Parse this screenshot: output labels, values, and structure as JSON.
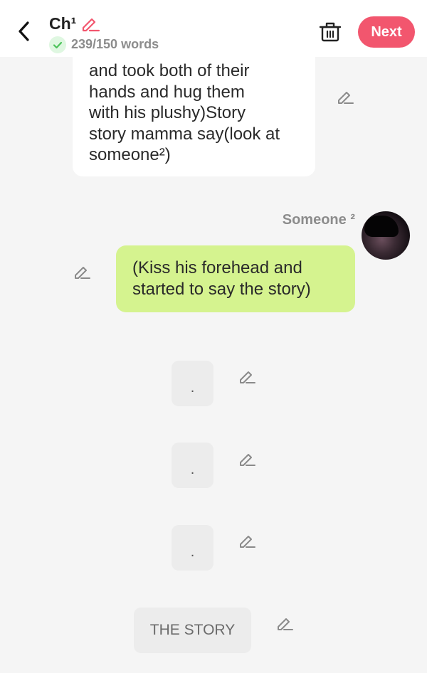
{
  "header": {
    "chapter_title": "Ch¹",
    "word_count": "239/150 words",
    "next_label": "Next"
  },
  "messages": [
    {
      "type": "text-bubble",
      "text": "and took both of their\nhands and hug them\nwith his plushy)Story\nstory mamma say(look at\nsomeone²)"
    },
    {
      "type": "speaker-bubble",
      "speaker": "Someone ²",
      "text": "(Kiss his forehead and started to say the story)",
      "background": "#d5f38f"
    },
    {
      "type": "narration",
      "text": "."
    },
    {
      "type": "narration",
      "text": "."
    },
    {
      "type": "narration",
      "text": "."
    },
    {
      "type": "narration",
      "text": "THE STORY"
    }
  ],
  "colors": {
    "accent": "#f2566e",
    "check": "#4cc35a",
    "edit_icon": "#8a8a8a",
    "background": "#f5f5f5"
  },
  "icons": [
    "back-arrow-icon",
    "pencil-icon",
    "check-icon",
    "trash-icon"
  ]
}
